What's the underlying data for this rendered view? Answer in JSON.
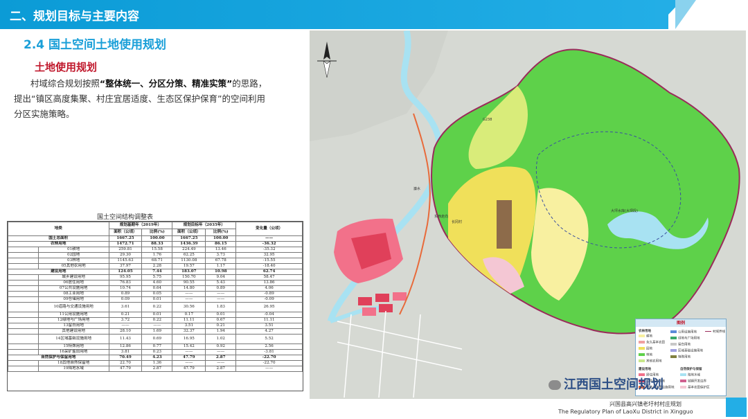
{
  "header": {
    "title": "二、规划目标与主要内容"
  },
  "section_title": "2.4  国土空间土地使用规划",
  "sub_title": "土地使用规划",
  "paragraph": {
    "p1": "村域综合规划按照",
    "p1_bold": "“整体统一、分区分策、精准实策”",
    "p1_end": "的思路，",
    "p2": "提出“镇区高度集聚、村庄宜居适度、生态区保护保育”的空间利用",
    "p3": "分区实施策略。"
  },
  "table": {
    "caption": "国土空间结构调整表",
    "headers": {
      "category": "地类",
      "base_year": "规划基期年（2019年）",
      "target_year": "规划目标年（2035年）",
      "area": "面积（公顷）",
      "ratio": "比例(%)",
      "change": "变化量（公顷）"
    },
    "rows": [
      {
        "c1": "国土总面积",
        "c2": "",
        "a1": "1667.25",
        "r1": "100.00",
        "a2": "1667.25",
        "r2": "100.00",
        "ch": "——",
        "cat": true
      },
      {
        "c1": "农林用地",
        "c2": "",
        "a1": "1472.71",
        "r1": "88.33",
        "a2": "1436.39",
        "r2": "86.15",
        "ch": "-36.32",
        "cat": true
      },
      {
        "c1": "",
        "c2": "01耕地",
        "a1": "259.81",
        "r1": "15.58",
        "a2": "224.49",
        "r2": "13.46",
        "ch": "-35.32"
      },
      {
        "c1": "",
        "c2": "02园地",
        "a1": "29.30",
        "r1": "1.76",
        "a2": "62.25",
        "r2": "3.73",
        "ch": "32.95"
      },
      {
        "c1": "",
        "c2": "03林地",
        "a1": "1145.63",
        "r1": "68.71",
        "a2": "1130.08",
        "r2": "67.78",
        "ch": "-15.55"
      },
      {
        "c1": "",
        "c2": "05其他农用地",
        "a1": "37.97",
        "r1": "2.28",
        "a2": "19.57",
        "r2": "1.17",
        "ch": "-18.40"
      },
      {
        "c1": "建设用地",
        "c2": "",
        "a1": "124.05",
        "r1": "7.44",
        "a2": "183.07",
        "r2": "10.98",
        "ch": "62.74",
        "cat": true
      },
      {
        "c1": "",
        "c2": "城乡建设用地",
        "a1": "95.95",
        "r1": "5.75",
        "a2": "150.70",
        "r2": "9.04",
        "ch": "58.47"
      },
      {
        "c1": "",
        "c2": "06居住用地",
        "a1": "76.83",
        "r1": "4.60",
        "a2": "90.55",
        "r2": "5.43",
        "ch": "13.86"
      },
      {
        "c1": "",
        "c2": "07公共设施用地",
        "a1": "10.74",
        "r1": "0.64",
        "a2": "14.80",
        "r2": "0.89",
        "ch": "4.06"
      },
      {
        "c1": "",
        "c2": "08工业用地",
        "a1": "0.89",
        "r1": "0.05",
        "a2": "——",
        "r2": "——",
        "ch": "-0.89"
      },
      {
        "c1": "",
        "c2": "09仓储用地",
        "a1": "0.09",
        "r1": "0.01",
        "a2": "——",
        "r2": "——",
        "ch": "-0.09"
      },
      {
        "c1": "",
        "c2": "10道路与交通设施用地",
        "a1": "3.61",
        "r1": "0.22",
        "a2": "30.56",
        "r2": "1.83",
        "ch": "26.95",
        "tall": true
      },
      {
        "c1": "",
        "c2": "11公用设施用地",
        "a1": "0.21",
        "r1": "0.01",
        "a2": "0.17",
        "r2": "0.01",
        "ch": "-0.04"
      },
      {
        "c1": "",
        "c2": "12绿地与广场用地",
        "a1": "3.72",
        "r1": "0.22",
        "a2": "11.11",
        "r2": "0.67",
        "ch": "11.11"
      },
      {
        "c1": "",
        "c2": "13留白用地",
        "a1": "——",
        "r1": "——",
        "a2": "3.51",
        "r2": "0.21",
        "ch": "3.51"
      },
      {
        "c1": "",
        "c2": "其他建设用地",
        "a1": "28.10",
        "r1": "1.69",
        "a2": "32.37",
        "r2": "1.94",
        "ch": "4.27"
      },
      {
        "c1": "",
        "c2": "14区域基础设施用地",
        "a1": "11.43",
        "r1": "0.69",
        "a2": "16.95",
        "r2": "1.02",
        "ch": "5.52",
        "tall": true
      },
      {
        "c1": "",
        "c2": "15特殊用地",
        "a1": "12.86",
        "r1": "0.77",
        "a2": "15.42",
        "r2": "0.92",
        "ch": "2.56"
      },
      {
        "c1": "",
        "c2": "16采矿盐田用地",
        "a1": "3.81",
        "r1": "0.23",
        "a2": "——",
        "r2": "——",
        "ch": "-3.81"
      },
      {
        "c1": "自然保护与保留用地",
        "c2": "",
        "a1": "70.49",
        "r1": "4.23",
        "a2": "47.79",
        "r2": "2.87",
        "ch": "-22.70",
        "cat": true
      },
      {
        "c1": "",
        "c2": "18其他自然保留地",
        "a1": "22.70",
        "r1": "1.36",
        "a2": "——",
        "r2": "——",
        "ch": "-22.70"
      },
      {
        "c1": "",
        "c2": "19陆地水域",
        "a1": "47.79",
        "r1": "2.87",
        "a2": "47.79",
        "r2": "2.87",
        "ch": "——"
      }
    ]
  },
  "map": {
    "labels": {
      "river": "濂水",
      "reservoir": "大坪水库(大坝段)",
      "road1": "G238",
      "road2": "东西走向",
      "town": "长冈村"
    },
    "legend": {
      "title": "图例",
      "agri": "农林用地",
      "construction": "建设用地",
      "nature": "自然保护与保留",
      "boundary": "村域界线",
      "items_left": [
        "耕地",
        "永久基本农田",
        "园地",
        "林地",
        "其他农用地"
      ],
      "items_mid": [
        "公用设施用地",
        "绿地与广场用地",
        "留白用地",
        "区域基础设施用地",
        "特殊用地"
      ],
      "items_bottom": [
        "居住用地",
        "公共设施用地",
        "道路与交通设施用地"
      ],
      "items_nat": [
        "陆地水域",
        "城镇开发边界",
        "基本农田保护区"
      ]
    },
    "colors": {
      "forest": "#5ed14a",
      "orchard": "#f0e05a",
      "farmland": "#f8f0a0",
      "residential": "#f2718a",
      "public": "#e0405a",
      "water": "#a8e2f2",
      "road": "#e86a3a",
      "industrial": "#8d6b4a",
      "other_ag": "#c9e88a"
    }
  },
  "watermark": "江西国土空间规划",
  "footer": {
    "cn": "兴国县高兴镇老圩村村庄规划",
    "en": "The Regulatory Plan of LaoXu District in Xingguo"
  }
}
